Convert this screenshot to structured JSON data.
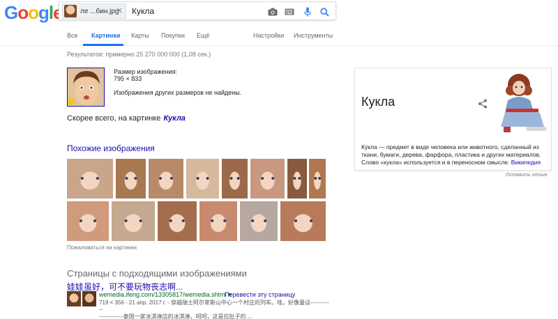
{
  "logo": {
    "letters": [
      "G",
      "o",
      "o",
      "g",
      "l",
      "e"
    ],
    "colors": [
      "#4285f4",
      "#ea4335",
      "#fbbc05",
      "#4285f4",
      "#34a853",
      "#ea4335"
    ]
  },
  "search": {
    "chip_label": "ле ...бин.jpg",
    "query": "Кукла"
  },
  "tabs": {
    "left": [
      {
        "label": "Все"
      },
      {
        "label": "Картинки",
        "active": true
      },
      {
        "label": "Карты"
      },
      {
        "label": "Покупки"
      },
      {
        "label": "Ещё"
      }
    ],
    "right": [
      {
        "label": "Настройки"
      },
      {
        "label": "Инструменты"
      }
    ]
  },
  "results_count": "Результатов: примерно 25 270 000 000 (1,08 сек.)",
  "query_image": {
    "size_label": "Размер изображения:",
    "size_value": "795 × 833",
    "no_other_sizes": "Изображения других размеров не найдены."
  },
  "best_guess": {
    "prefix": "Скорее всего, на картинке",
    "term": "Кукла"
  },
  "similar": {
    "title": "Похожие изображения",
    "report": "Пожаловаться на картинки",
    "thumb_colors": [
      "#c9a58a",
      "#a8784f",
      "#b88a6a",
      "#d6b89c",
      "#9c6a4a",
      "#c89880",
      "#8a5a3e",
      "#b07850",
      "#d09a7c",
      "#c4a890",
      "#a46e4e",
      "#c88a6e",
      "#b4a8a0",
      "#b87a5a"
    ]
  },
  "pages": {
    "title": "Страницы с подходящими изображениями",
    "result_title": "娃娃虽好，可不要玩物丧志啊...",
    "url": "wemedia.ifeng.com/13305817/wemedia.shtml",
    "translate": "Перевести эту страницу",
    "snippet_line1": "719 × 356 - 21 апр. 2017 г. - 穿越瑞士阿尔卑斯山中心一个村庄的列车。哇，好像童话------------",
    "snippet_line2": "-------------泰国一家冰淇淋店的冰淇淋，呵呵，这是拉肚子的 ..."
  },
  "knowledge_panel": {
    "title": "Кукла",
    "description": "Ку́кла — предмет в виде человека или животного, сделанный из ткани, бумаги, дерева, фарфора, пластика и других материалов. Слово «кукла» используется и в переносном смысле.",
    "wiki_link": "Википедия"
  },
  "feedback": "Оставить отзыв"
}
